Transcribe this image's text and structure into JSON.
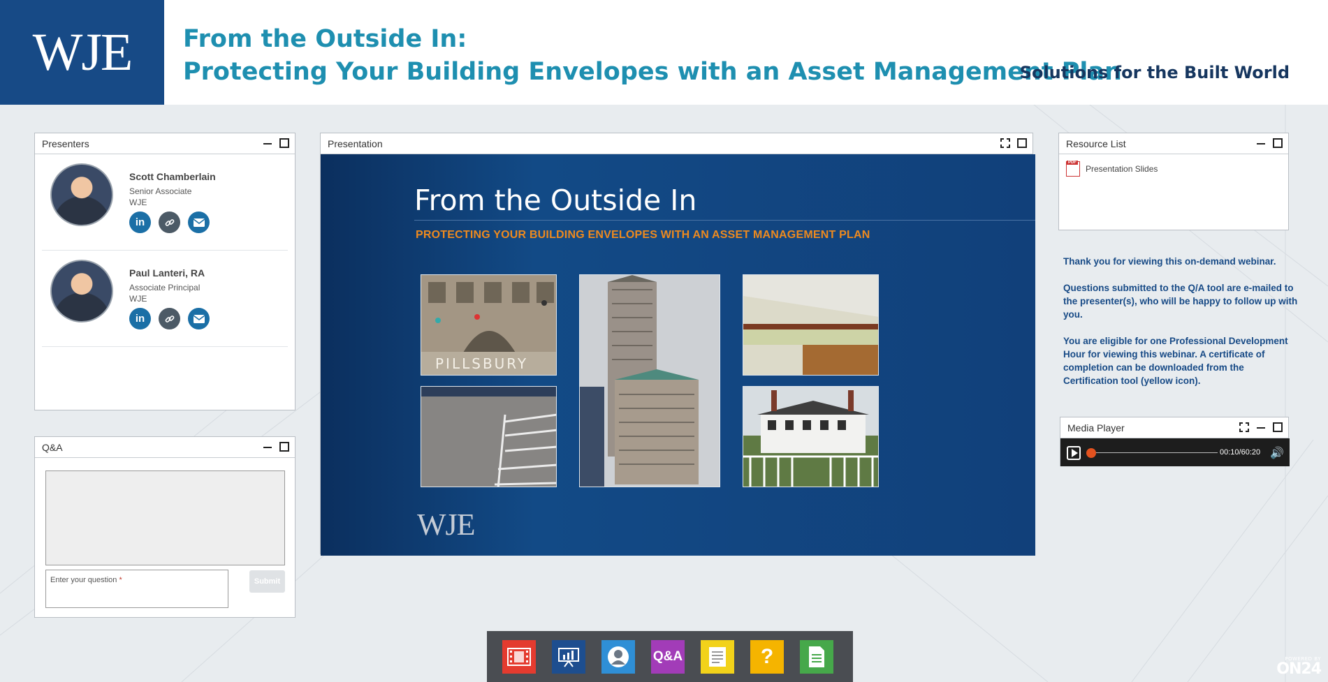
{
  "header": {
    "logo": "WJE",
    "title_line1": "From the Outside In:",
    "title_line2": "Protecting Your Building Envelopes with an Asset Management Plan",
    "tagline": "Solutions for the Built World"
  },
  "presenters_panel": {
    "title": "Presenters",
    "presenters": [
      {
        "name": "Scott Chamberlain",
        "role": "Senior Associate",
        "org": "WJE"
      },
      {
        "name": "Paul Lanteri, RA",
        "role": "Associate Principal",
        "org": "WJE"
      }
    ],
    "social_icons": [
      "linkedin-icon",
      "link-icon",
      "email-icon"
    ]
  },
  "qa_panel": {
    "title": "Q&A",
    "input_placeholder": "Enter your question",
    "required_mark": "*",
    "submit_label": "Submit"
  },
  "presentation_panel": {
    "title": "Presentation",
    "slide": {
      "title": "From the Outside In",
      "subtitle": "PROTECTING YOUR BUILDING ENVELOPES WITH AN ASSET MANAGEMENT PLAN",
      "logo": "WJE",
      "photo_sign_text": "PILLSBURY"
    }
  },
  "resource_panel": {
    "title": "Resource List",
    "items": [
      {
        "label": "Presentation Slides",
        "icon": "pdf-icon"
      }
    ]
  },
  "info": {
    "para1": "Thank you for viewing this on-demand webinar.",
    "para2": "Questions submitted to the Q/A tool are e-mailed to the presenter(s), who will be happy to follow up with you.",
    "para3": "You are eligible for one Professional Development Hour for viewing this webinar. A certificate of completion can be downloaded from the Certification tool (yellow icon)."
  },
  "media_player": {
    "title": "Media Player",
    "time": "00:10/60:20",
    "progress": 0.003
  },
  "dock": {
    "items": [
      {
        "name": "media-player-tool",
        "icon": "film-icon",
        "color": "#e43b2f"
      },
      {
        "name": "presentation-tool",
        "icon": "slides-icon",
        "color": "#1d4e8f"
      },
      {
        "name": "presenters-tool",
        "icon": "person-icon",
        "color": "#2f8fd6"
      },
      {
        "name": "qa-tool",
        "label": "Q&A",
        "color": "#a23cb8"
      },
      {
        "name": "notes-tool",
        "icon": "notes-icon",
        "color": "#f2d21a"
      },
      {
        "name": "help-tool",
        "label": "?",
        "color": "#f5b400"
      },
      {
        "name": "resources-tool",
        "icon": "document-icon",
        "color": "#46a84a"
      }
    ]
  },
  "powered_by": {
    "small": "POWERED BY",
    "brand": "ON24"
  },
  "colors": {
    "brand_blue": "#174a86",
    "title_teal": "#1e8fb0",
    "accent_orange": "#ee8a1e"
  }
}
